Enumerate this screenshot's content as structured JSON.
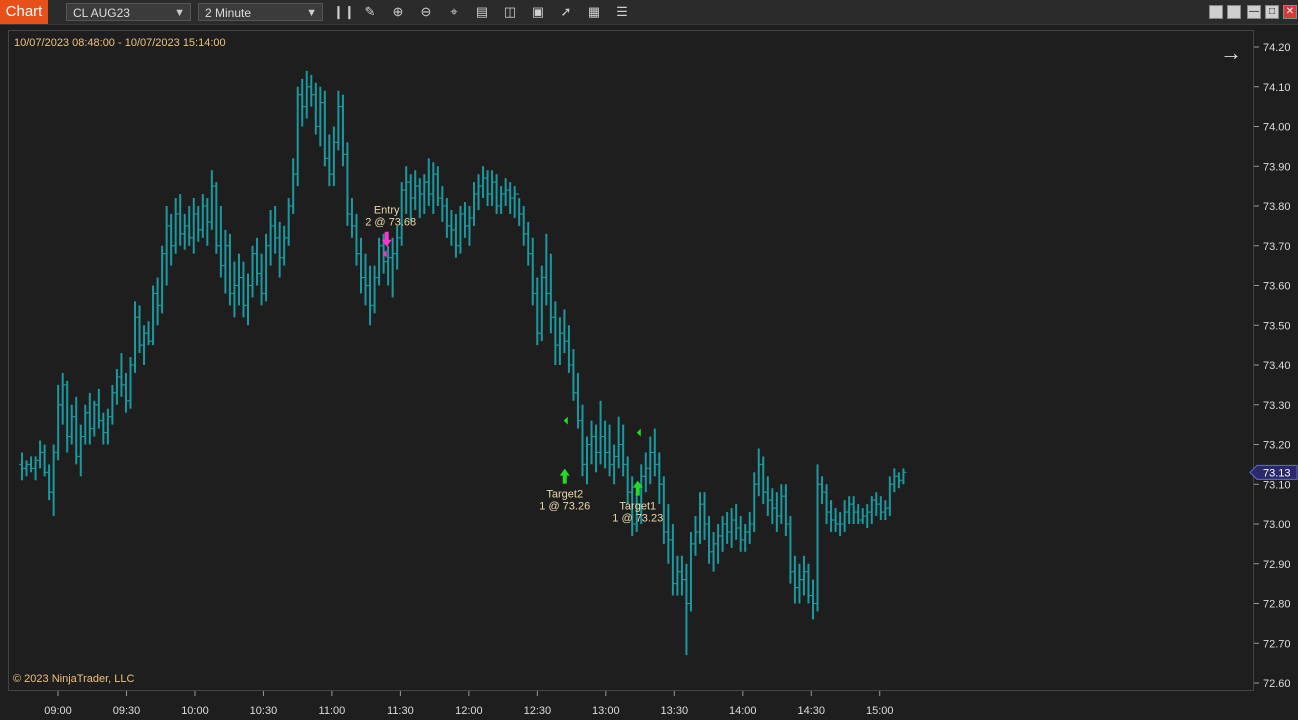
{
  "toolbar": {
    "chart_tab": "Chart",
    "instrument": "CL AUG23",
    "interval": "2 Minute"
  },
  "chart": {
    "range_label": "10/07/2023 08:48:00 - 10/07/2023 15:14:00",
    "copyright": "© 2023 NinjaTrader, LLC",
    "colors": {
      "bar": "#1a9aa0",
      "entry": "#ff33cc",
      "target": "#22dd22",
      "price_tag": "#2a2a6a"
    }
  },
  "chart_data": {
    "type": "ohlc",
    "symbol": "CL AUG23",
    "interval": "2 Minute",
    "ylim": [
      72.6,
      74.2
    ],
    "y_ticks": [
      "74.20",
      "74.10",
      "74.00",
      "73.90",
      "73.80",
      "73.70",
      "73.60",
      "73.50",
      "73.40",
      "73.30",
      "73.20",
      "73.10",
      "73.00",
      "72.90",
      "72.80",
      "72.70",
      "72.60"
    ],
    "x_ticks": [
      "09:00",
      "09:30",
      "10:00",
      "10:30",
      "11:00",
      "11:30",
      "12:00",
      "12:30",
      "13:00",
      "13:30",
      "14:00",
      "14:30",
      "15:00"
    ],
    "last_price": "73.13",
    "annotations": [
      {
        "name": "Entry",
        "detail": "2 @ 73.68",
        "time": "11:24",
        "price": 73.68,
        "side": "sell"
      },
      {
        "name": "Target2",
        "detail": "1 @ 73.26",
        "time": "12:42",
        "price": 73.26,
        "side": "buy"
      },
      {
        "name": "Target1",
        "detail": "1 @ 73.23",
        "time": "13:14",
        "price": 73.23,
        "side": "buy"
      }
    ],
    "bars": [
      [
        73.15,
        73.18,
        73.11,
        73.14
      ],
      [
        73.14,
        73.16,
        73.12,
        73.15
      ],
      [
        73.15,
        73.17,
        73.13,
        73.14
      ],
      [
        73.14,
        73.17,
        73.11,
        73.16
      ],
      [
        73.16,
        73.21,
        73.14,
        73.18
      ],
      [
        73.18,
        73.2,
        73.12,
        73.13
      ],
      [
        73.13,
        73.15,
        73.06,
        73.08
      ],
      [
        73.08,
        73.2,
        73.02,
        73.18
      ],
      [
        73.18,
        73.35,
        73.16,
        73.3
      ],
      [
        73.3,
        73.38,
        73.25,
        73.35
      ],
      [
        73.35,
        73.36,
        73.18,
        73.22
      ],
      [
        73.22,
        73.3,
        73.2,
        73.27
      ],
      [
        73.27,
        73.32,
        73.15,
        73.17
      ],
      [
        73.17,
        73.25,
        73.12,
        73.22
      ],
      [
        73.22,
        73.3,
        73.2,
        73.28
      ],
      [
        73.28,
        73.33,
        73.2,
        73.24
      ],
      [
        73.24,
        73.31,
        73.22,
        73.3
      ],
      [
        73.3,
        73.34,
        73.24,
        73.26
      ],
      [
        73.26,
        73.28,
        73.2,
        73.23
      ],
      [
        73.23,
        73.29,
        73.2,
        73.27
      ],
      [
        73.27,
        73.35,
        73.25,
        73.33
      ],
      [
        73.33,
        73.39,
        73.3,
        73.37
      ],
      [
        73.37,
        73.43,
        73.32,
        73.35
      ],
      [
        73.35,
        73.38,
        73.28,
        73.31
      ],
      [
        73.31,
        73.42,
        73.29,
        73.4
      ],
      [
        73.4,
        73.56,
        73.38,
        73.52
      ],
      [
        73.52,
        73.55,
        73.43,
        73.45
      ],
      [
        73.45,
        73.5,
        73.4,
        73.48
      ],
      [
        73.48,
        73.51,
        73.45,
        73.46
      ],
      [
        73.46,
        73.6,
        73.45,
        73.58
      ],
      [
        73.58,
        73.62,
        73.5,
        73.55
      ],
      [
        73.55,
        73.7,
        73.53,
        73.68
      ],
      [
        73.68,
        73.8,
        73.6,
        73.75
      ],
      [
        73.75,
        73.78,
        73.65,
        73.7
      ],
      [
        73.7,
        73.82,
        73.68,
        73.78
      ],
      [
        73.78,
        73.83,
        73.7,
        73.73
      ],
      [
        73.73,
        73.78,
        73.69,
        73.75
      ],
      [
        73.75,
        73.8,
        73.7,
        73.72
      ],
      [
        73.72,
        73.82,
        73.68,
        73.78
      ],
      [
        73.78,
        73.8,
        73.71,
        73.74
      ],
      [
        73.74,
        73.83,
        73.72,
        73.8
      ],
      [
        73.8,
        73.82,
        73.7,
        73.76
      ],
      [
        73.76,
        73.89,
        73.74,
        73.85
      ],
      [
        73.85,
        73.86,
        73.68,
        73.7
      ],
      [
        73.7,
        73.8,
        73.62,
        73.65
      ],
      [
        73.65,
        73.74,
        73.58,
        73.7
      ],
      [
        73.7,
        73.73,
        73.55,
        73.58
      ],
      [
        73.58,
        73.66,
        73.52,
        73.6
      ],
      [
        73.6,
        73.68,
        73.55,
        73.62
      ],
      [
        73.62,
        73.66,
        73.52,
        73.55
      ],
      [
        73.55,
        73.63,
        73.5,
        73.6
      ],
      [
        73.6,
        73.7,
        73.57,
        73.68
      ],
      [
        73.68,
        73.72,
        73.6,
        73.63
      ],
      [
        73.63,
        73.68,
        73.55,
        73.58
      ],
      [
        73.58,
        73.73,
        73.56,
        73.7
      ],
      [
        73.7,
        73.79,
        73.65,
        73.75
      ],
      [
        73.75,
        73.8,
        73.68,
        73.72
      ],
      [
        73.72,
        73.76,
        73.62,
        73.67
      ],
      [
        73.67,
        73.75,
        73.65,
        73.72
      ],
      [
        73.72,
        73.82,
        73.7,
        73.8
      ],
      [
        73.8,
        73.92,
        73.78,
        73.88
      ],
      [
        73.88,
        74.1,
        73.85,
        74.08
      ],
      [
        74.08,
        74.12,
        74.0,
        74.05
      ],
      [
        74.05,
        74.14,
        74.02,
        74.1
      ],
      [
        74.1,
        74.13,
        74.05,
        74.08
      ],
      [
        74.08,
        74.11,
        73.98,
        74.0
      ],
      [
        74.0,
        74.1,
        73.95,
        74.06
      ],
      [
        74.06,
        74.09,
        73.9,
        73.92
      ],
      [
        73.92,
        73.98,
        73.85,
        73.88
      ],
      [
        73.88,
        74.0,
        73.85,
        73.96
      ],
      [
        73.96,
        74.09,
        73.94,
        74.05
      ],
      [
        74.05,
        74.08,
        73.9,
        73.93
      ],
      [
        73.93,
        73.96,
        73.75,
        73.78
      ],
      [
        73.78,
        73.82,
        73.72,
        73.75
      ],
      [
        73.75,
        73.78,
        73.65,
        73.68
      ],
      [
        73.68,
        73.72,
        73.58,
        73.62
      ],
      [
        73.62,
        73.68,
        73.55,
        73.6
      ],
      [
        73.6,
        73.65,
        73.5,
        73.55
      ],
      [
        73.55,
        73.65,
        73.53,
        73.62
      ],
      [
        73.62,
        73.72,
        73.6,
        73.7
      ],
      [
        73.7,
        73.73,
        73.63,
        73.66
      ],
      [
        73.66,
        73.7,
        73.6,
        73.67
      ],
      [
        73.67,
        73.72,
        73.57,
        73.68
      ],
      [
        73.68,
        73.75,
        73.64,
        73.72
      ],
      [
        73.72,
        73.86,
        73.7,
        73.84
      ],
      [
        73.84,
        73.9,
        73.78,
        73.86
      ],
      [
        73.86,
        73.88,
        73.76,
        73.82
      ],
      [
        73.82,
        73.89,
        73.79,
        73.85
      ],
      [
        73.85,
        73.87,
        73.77,
        73.83
      ],
      [
        73.83,
        73.88,
        73.78,
        73.86
      ],
      [
        73.86,
        73.92,
        73.8,
        73.83
      ],
      [
        73.83,
        73.91,
        73.78,
        73.88
      ],
      [
        73.88,
        73.9,
        73.8,
        73.82
      ],
      [
        73.82,
        73.85,
        73.76,
        73.8
      ],
      [
        73.8,
        73.82,
        73.72,
        73.75
      ],
      [
        73.75,
        73.79,
        73.7,
        73.74
      ],
      [
        73.74,
        73.78,
        73.67,
        73.7
      ],
      [
        73.7,
        73.8,
        73.68,
        73.78
      ],
      [
        73.78,
        73.81,
        73.72,
        73.75
      ],
      [
        73.75,
        73.8,
        73.7,
        73.77
      ],
      [
        73.77,
        73.86,
        73.75,
        73.83
      ],
      [
        73.83,
        73.88,
        73.79,
        73.85
      ],
      [
        73.85,
        73.9,
        73.82,
        73.87
      ],
      [
        73.87,
        73.89,
        73.8,
        73.83
      ],
      [
        73.83,
        73.89,
        73.8,
        73.86
      ],
      [
        73.86,
        73.88,
        73.78,
        73.8
      ],
      [
        73.8,
        73.85,
        73.78,
        73.83
      ],
      [
        73.83,
        73.87,
        73.8,
        73.84
      ],
      [
        73.84,
        73.86,
        73.78,
        73.82
      ],
      [
        73.82,
        73.85,
        73.77,
        73.83
      ],
      [
        73.83,
        73.82,
        73.75,
        73.78
      ],
      [
        73.78,
        73.8,
        73.7,
        73.73
      ],
      [
        73.73,
        73.76,
        73.65,
        73.68
      ],
      [
        73.68,
        73.72,
        73.55,
        73.58
      ],
      [
        73.58,
        73.62,
        73.45,
        73.48
      ],
      [
        73.48,
        73.65,
        73.46,
        73.62
      ],
      [
        73.62,
        73.73,
        73.55,
        73.58
      ],
      [
        73.58,
        73.68,
        73.48,
        73.52
      ],
      [
        73.52,
        73.56,
        73.4,
        73.45
      ],
      [
        73.45,
        73.52,
        73.4,
        73.48
      ],
      [
        73.48,
        73.54,
        73.43,
        73.46
      ],
      [
        73.46,
        73.5,
        73.38,
        73.4
      ],
      [
        73.4,
        73.44,
        73.31,
        73.33
      ],
      [
        73.33,
        73.38,
        73.24,
        73.26
      ],
      [
        73.26,
        73.3,
        73.12,
        73.15
      ],
      [
        73.15,
        73.22,
        73.1,
        73.2
      ],
      [
        73.2,
        73.26,
        73.15,
        73.22
      ],
      [
        73.22,
        73.25,
        73.13,
        73.18
      ],
      [
        73.18,
        73.31,
        73.15,
        73.22
      ],
      [
        73.22,
        73.26,
        73.14,
        73.18
      ],
      [
        73.18,
        73.25,
        73.12,
        73.15
      ],
      [
        73.15,
        73.2,
        73.1,
        73.17
      ],
      [
        73.17,
        73.27,
        73.14,
        73.2
      ],
      [
        73.2,
        73.25,
        73.12,
        73.15
      ],
      [
        73.15,
        73.17,
        73.05,
        73.08
      ],
      [
        73.08,
        73.12,
        72.97,
        73.0
      ],
      [
        73.0,
        73.08,
        72.98,
        73.05
      ],
      [
        73.05,
        73.15,
        73.0,
        73.12
      ],
      [
        73.12,
        73.18,
        73.08,
        73.14
      ],
      [
        73.14,
        73.22,
        73.1,
        73.18
      ],
      [
        73.18,
        73.24,
        73.12,
        73.15
      ],
      [
        73.15,
        73.18,
        73.05,
        73.1
      ],
      [
        73.1,
        73.12,
        72.95,
        72.98
      ],
      [
        72.98,
        73.05,
        72.9,
        72.96
      ],
      [
        72.96,
        73.0,
        72.82,
        72.85
      ],
      [
        72.85,
        72.92,
        72.82,
        72.88
      ],
      [
        72.88,
        72.92,
        72.82,
        72.86
      ],
      [
        72.86,
        72.9,
        72.67,
        72.8
      ],
      [
        72.8,
        72.98,
        72.78,
        72.95
      ],
      [
        72.95,
        73.02,
        72.92,
        72.98
      ],
      [
        72.98,
        73.08,
        72.95,
        73.05
      ],
      [
        73.05,
        73.08,
        72.96,
        73.0
      ],
      [
        73.0,
        73.02,
        72.9,
        72.93
      ],
      [
        72.93,
        72.98,
        72.88,
        72.95
      ],
      [
        72.95,
        73.0,
        72.9,
        72.97
      ],
      [
        72.97,
        73.02,
        72.93,
        73.0
      ],
      [
        73.0,
        73.03,
        72.95,
        72.98
      ],
      [
        72.98,
        73.04,
        72.94,
        73.01
      ],
      [
        73.01,
        73.05,
        72.96,
        72.99
      ],
      [
        72.99,
        73.02,
        72.93,
        72.96
      ],
      [
        72.96,
        73.0,
        72.93,
        72.98
      ],
      [
        72.98,
        73.03,
        72.95,
        73.0
      ],
      [
        73.0,
        73.13,
        72.98,
        73.1
      ],
      [
        73.1,
        73.19,
        73.07,
        73.15
      ],
      [
        73.15,
        73.17,
        73.05,
        73.08
      ],
      [
        73.08,
        73.12,
        73.02,
        73.06
      ],
      [
        73.06,
        73.09,
        73.0,
        73.04
      ],
      [
        73.04,
        73.08,
        72.98,
        73.02
      ],
      [
        73.02,
        73.1,
        73.0,
        73.07
      ],
      [
        73.07,
        73.1,
        72.97,
        73.0
      ],
      [
        73.0,
        73.02,
        72.85,
        72.88
      ],
      [
        72.88,
        72.92,
        72.8,
        72.84
      ],
      [
        72.84,
        72.9,
        72.8,
        72.86
      ],
      [
        72.86,
        72.92,
        72.82,
        72.88
      ],
      [
        72.88,
        72.9,
        72.8,
        72.82
      ],
      [
        72.82,
        72.86,
        72.76,
        72.8
      ],
      [
        72.8,
        73.15,
        72.78,
        73.1
      ],
      [
        73.1,
        73.12,
        73.05,
        73.08
      ],
      [
        73.08,
        73.1,
        73.0,
        73.03
      ],
      [
        73.03,
        73.06,
        72.98,
        73.01
      ],
      [
        73.01,
        73.04,
        72.98,
        73.0
      ],
      [
        73.0,
        73.03,
        72.97,
        73.0
      ],
      [
        73.0,
        73.06,
        72.98,
        73.03
      ],
      [
        73.03,
        73.07,
        73.0,
        73.05
      ],
      [
        73.05,
        73.07,
        73.0,
        73.03
      ],
      [
        73.03,
        73.05,
        73.0,
        73.01
      ],
      [
        73.01,
        73.04,
        73.0,
        73.02
      ],
      [
        73.02,
        73.05,
        72.99,
        73.03
      ],
      [
        73.03,
        73.07,
        73.0,
        73.06
      ],
      [
        73.06,
        73.08,
        73.02,
        73.05
      ],
      [
        73.05,
        73.07,
        73.01,
        73.03
      ],
      [
        73.03,
        73.06,
        73.01,
        73.04
      ],
      [
        73.04,
        73.12,
        73.02,
        73.1
      ],
      [
        73.1,
        73.14,
        73.08,
        73.12
      ],
      [
        73.12,
        73.13,
        73.09,
        73.11
      ],
      [
        73.11,
        73.14,
        73.1,
        73.13
      ]
    ]
  }
}
